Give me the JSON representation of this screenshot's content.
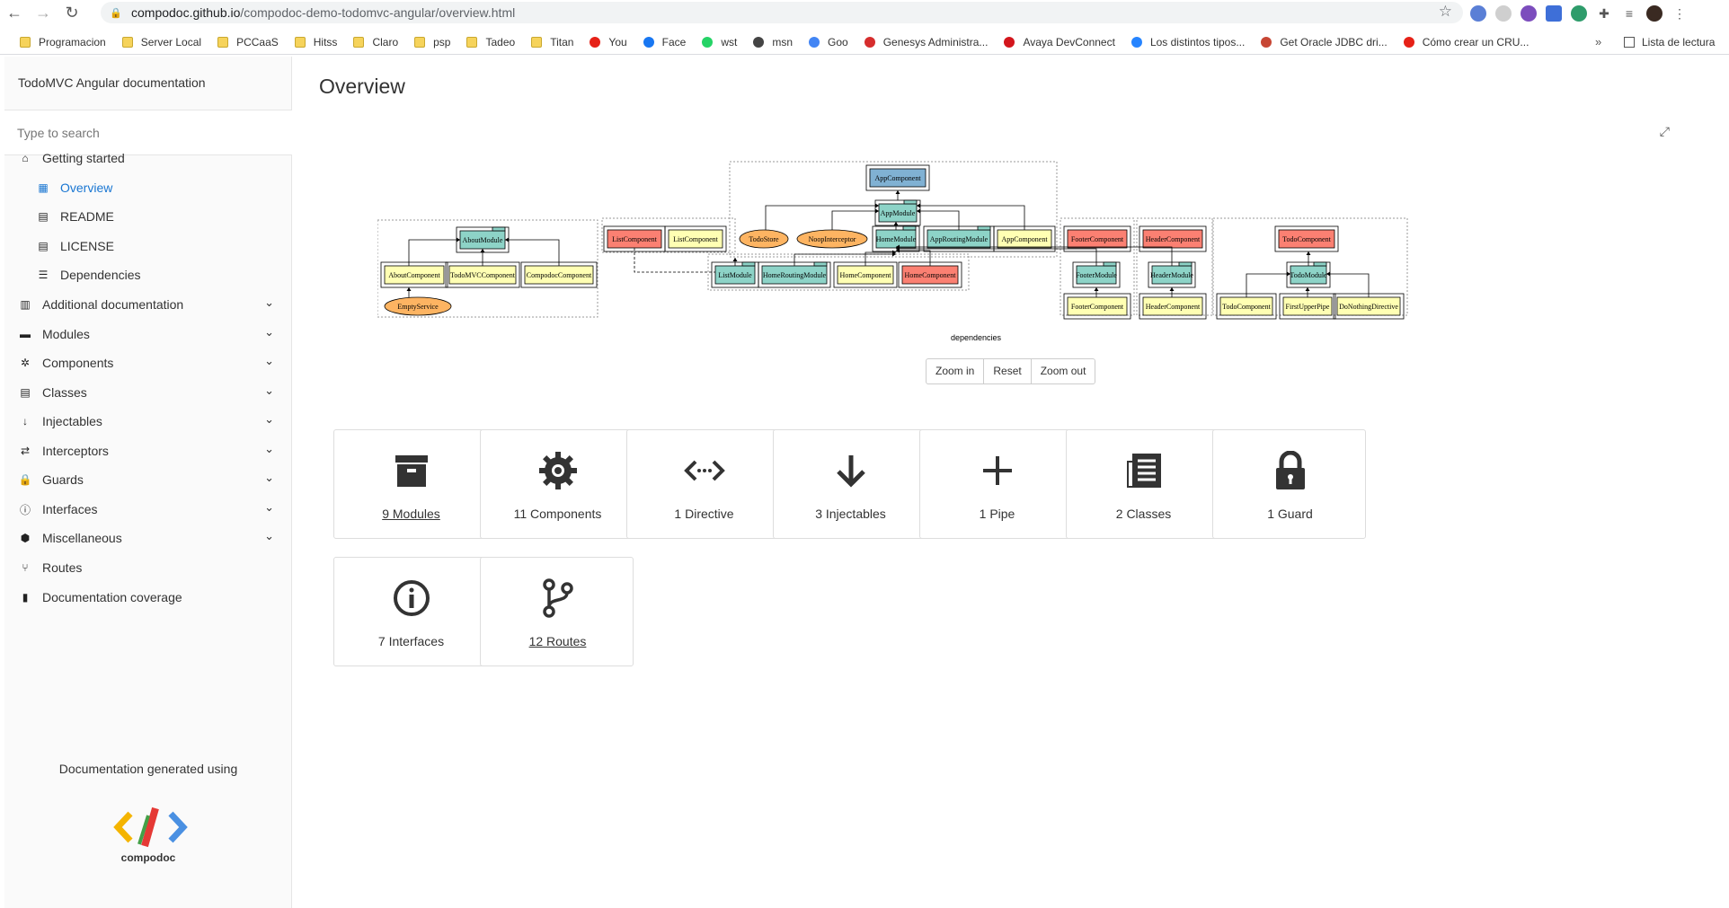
{
  "browser": {
    "url_host": "compodoc.github.io",
    "url_path": "/compodoc-demo-todomvc-angular/overview.html",
    "bookmarks": [
      {
        "label": "Programacion",
        "icon": "folder-icon"
      },
      {
        "label": "Server Local",
        "icon": "folder-icon"
      },
      {
        "label": "PCCaaS",
        "icon": "folder-icon"
      },
      {
        "label": "Hitss",
        "icon": "folder-icon"
      },
      {
        "label": "Claro",
        "icon": "folder-icon"
      },
      {
        "label": "psp",
        "icon": "folder-icon"
      },
      {
        "label": "Tadeo",
        "icon": "folder-icon"
      },
      {
        "label": "Titan",
        "icon": "folder-icon"
      },
      {
        "label": "You",
        "icon": "youtube-icon"
      },
      {
        "label": "Face",
        "icon": "facebook-icon"
      },
      {
        "label": "wst",
        "icon": "whatsapp-icon"
      },
      {
        "label": "msn",
        "icon": "globe-icon"
      },
      {
        "label": "Goo",
        "icon": "google-icon"
      },
      {
        "label": "Genesys Administra...",
        "icon": "genesys-icon"
      },
      {
        "label": "Avaya DevConnect",
        "icon": "avaya-icon"
      },
      {
        "label": "Los distintos tipos...",
        "icon": "atlassian-icon"
      },
      {
        "label": "Get Oracle JDBC dri...",
        "icon": "oracle-icon"
      },
      {
        "label": "Cómo crear un CRU...",
        "icon": "youtube-icon"
      }
    ],
    "reading_list": "Lista de lectura",
    "more": "»"
  },
  "sidebar": {
    "title": "TodoMVC Angular documentation",
    "search_placeholder": "Type to search",
    "items": [
      {
        "label": "Getting started",
        "icon": "home-icon",
        "glyph": "⌂"
      },
      {
        "label": "Overview",
        "icon": "grid-icon",
        "glyph": "▦"
      },
      {
        "label": "README",
        "icon": "book-icon",
        "glyph": "▤"
      },
      {
        "label": "LICENSE",
        "icon": "book-icon",
        "glyph": "▤"
      },
      {
        "label": "Dependencies",
        "icon": "list-icon",
        "glyph": "☰"
      },
      {
        "label": "Additional documentation",
        "icon": "open-book-icon",
        "glyph": "▥"
      },
      {
        "label": "Modules",
        "icon": "archive-icon",
        "glyph": "▬"
      },
      {
        "label": "Components",
        "icon": "gear-icon",
        "glyph": "✲"
      },
      {
        "label": "Classes",
        "icon": "file-icon",
        "glyph": "▤"
      },
      {
        "label": "Injectables",
        "icon": "arrow-down-icon",
        "glyph": "↓"
      },
      {
        "label": "Interceptors",
        "icon": "exchange-icon",
        "glyph": "⇄"
      },
      {
        "label": "Guards",
        "icon": "lock-icon",
        "glyph": "🔒"
      },
      {
        "label": "Interfaces",
        "icon": "info-icon",
        "glyph": "ⓘ"
      },
      {
        "label": "Miscellaneous",
        "icon": "cube-icon",
        "glyph": "⬢"
      },
      {
        "label": "Routes",
        "icon": "branch-icon",
        "glyph": "⑂"
      },
      {
        "label": "Documentation coverage",
        "icon": "bar-chart-icon",
        "glyph": "▮"
      }
    ],
    "generated_using": "Documentation generated using",
    "logo_text": "compodoc"
  },
  "main": {
    "title": "Overview",
    "graph_caption": "dependencies",
    "zoom": {
      "in": "Zoom in",
      "reset": "Reset",
      "out": "Zoom out"
    },
    "cards": [
      {
        "label": "9 Modules",
        "icon": "archive-icon",
        "link": true
      },
      {
        "label": "11 Components",
        "icon": "gear-icon",
        "link": false
      },
      {
        "label": "1 Directive",
        "icon": "code-icon",
        "link": false
      },
      {
        "label": "3 Injectables",
        "icon": "arrow-down-icon",
        "link": false
      },
      {
        "label": "1 Pipe",
        "icon": "plus-icon",
        "link": false
      },
      {
        "label": "2 Classes",
        "icon": "file-text-icon",
        "link": false
      },
      {
        "label": "1 Guard",
        "icon": "lock-icon",
        "link": false
      },
      {
        "label": "7 Interfaces",
        "icon": "info-icon",
        "link": false
      },
      {
        "label": "12 Routes",
        "icon": "branch-icon",
        "link": true
      }
    ]
  },
  "graph": {
    "colors": {
      "module": "#8dd3c7",
      "component": "#ffffb3",
      "injectable": "#fdb462",
      "bootstrap": "#80b1d3",
      "export": "#fb8072"
    },
    "nodes": [
      {
        "label": "AppComponent",
        "kind": "bootstrap"
      },
      {
        "label": "AppModule",
        "kind": "module"
      },
      {
        "label": "AboutModule",
        "kind": "module"
      },
      {
        "label": "AboutComponent",
        "kind": "component"
      },
      {
        "label": "TodoMVCComponent",
        "kind": "component"
      },
      {
        "label": "CompodocComponent",
        "kind": "component"
      },
      {
        "label": "EmptyService",
        "kind": "injectable"
      },
      {
        "label": "ListComponent",
        "kind": "export"
      },
      {
        "label": "ListComponent",
        "kind": "component"
      },
      {
        "label": "TodoStore",
        "kind": "injectable"
      },
      {
        "label": "NoopInterceptor",
        "kind": "injectable"
      },
      {
        "label": "HomeModule",
        "kind": "module"
      },
      {
        "label": "AppRoutingModule",
        "kind": "module"
      },
      {
        "label": "AppComponent",
        "kind": "component"
      },
      {
        "label": "ListModule",
        "kind": "module"
      },
      {
        "label": "HomeRoutingModule",
        "kind": "module"
      },
      {
        "label": "HomeComponent",
        "kind": "component"
      },
      {
        "label": "HomeComponent",
        "kind": "export"
      },
      {
        "label": "FooterComponent",
        "kind": "export"
      },
      {
        "label": "FooterModule",
        "kind": "module"
      },
      {
        "label": "FooterComponent",
        "kind": "component"
      },
      {
        "label": "HeaderComponent",
        "kind": "export"
      },
      {
        "label": "HeaderModule",
        "kind": "module"
      },
      {
        "label": "HeaderComponent",
        "kind": "component"
      },
      {
        "label": "TodoComponent",
        "kind": "export"
      },
      {
        "label": "TodoModule",
        "kind": "module"
      },
      {
        "label": "TodoComponent",
        "kind": "component"
      },
      {
        "label": "FirstUpperPipe",
        "kind": "component"
      },
      {
        "label": "DoNothingDirective",
        "kind": "component"
      }
    ]
  }
}
